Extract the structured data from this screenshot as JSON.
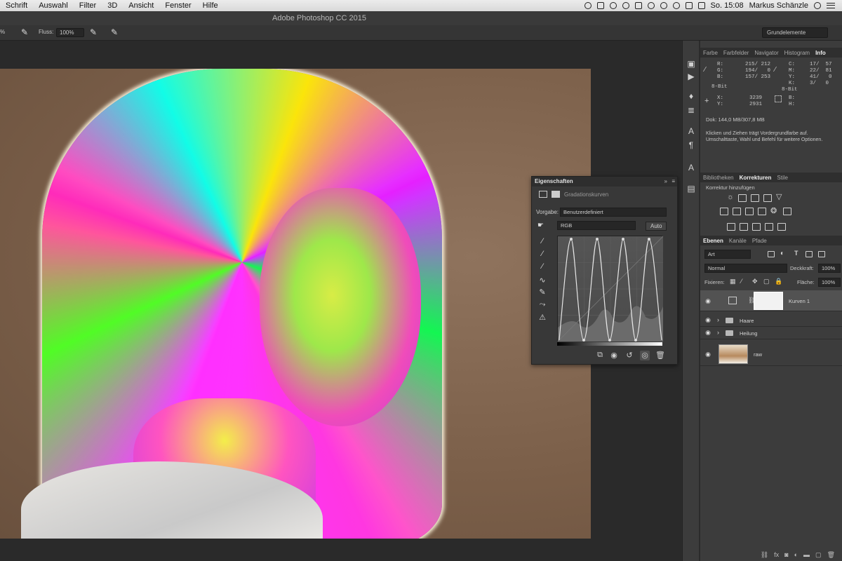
{
  "menubar": {
    "items": [
      "Schrift",
      "Auswahl",
      "Filter",
      "3D",
      "Ansicht",
      "Fenster",
      "Hilfe"
    ],
    "clock": "So. 15:08",
    "user": "Markus Schänzle"
  },
  "app": {
    "title": "Adobe Photoshop CC 2015"
  },
  "options": {
    "opacity_value": "%",
    "flow_label": "Fluss:",
    "flow_value": "100%",
    "workspace": "Grundelemente"
  },
  "info_panel": {
    "tabs": [
      "Farbe",
      "Farbfelder",
      "Navigator",
      "Histogram",
      "Info"
    ],
    "active_tab": "Info",
    "rgb": {
      "r": "R:",
      "r_val": "215/ 212",
      "g": "G:",
      "g_val": "194/   0",
      "b": "B:",
      "b_val": "157/ 253"
    },
    "cmyk": {
      "c": "C:",
      "c_val": "17/  57",
      "m": "M:",
      "m_val": "22/  81",
      "y": "Y:",
      "y_val": "41/   0",
      "k": "K:",
      "k_val": "3/   0"
    },
    "bit_left": "8-Bit",
    "bit_right": "8-Bit",
    "x_label": "X:",
    "x_val": "3239",
    "y_label": "Y:",
    "y_val": "2931",
    "b_label": "B:",
    "h_label": "H:",
    "doc": "Dok: 144,0 MB/307,8 MB",
    "hint": "Klicken und Ziehen trägt Vordergrundfarbe auf.\nUmschalttaste, Wahl und Befehl für weitere Optionen."
  },
  "adjustments_panel": {
    "tabs": [
      "Bibliotheken",
      "Korrekturen",
      "Stile"
    ],
    "active_tab": "Korrekturen",
    "subtitle": "Korrektur hinzufügen"
  },
  "layers_panel": {
    "tabs": [
      "Ebenen",
      "Kanäle",
      "Pfade"
    ],
    "active_tab": "Ebenen",
    "filter_kind": "Art",
    "blend_mode": "Normal",
    "opacity_label": "Deckkraft:",
    "opacity_value": "100%",
    "lock_label": "Fixieren:",
    "fill_label": "Fläche:",
    "fill_value": "100%",
    "layers": [
      {
        "name": "Kurven 1"
      },
      {
        "name": "Haare"
      },
      {
        "name": "Heilung"
      },
      {
        "name": "raw"
      }
    ]
  },
  "properties_panel": {
    "title": "Eigenschaften",
    "adjustment": "Gradationskurven",
    "preset_label": "Vorgabe:",
    "preset_value": "Benutzerdefiniert",
    "channel": "RGB",
    "auto_button": "Auto"
  },
  "colors": {
    "accent": "#f0f0f0",
    "panel": "#3c3c3c",
    "background": "#2b2b2b"
  }
}
